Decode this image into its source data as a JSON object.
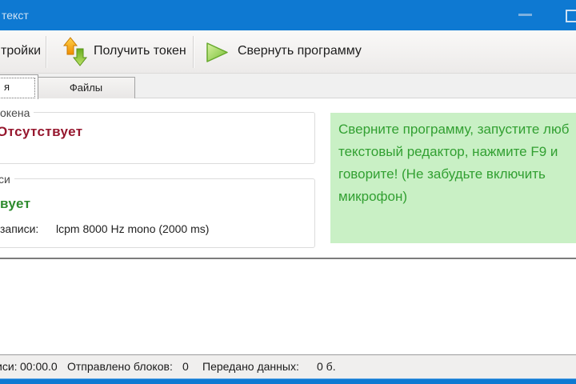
{
  "window": {
    "title_fragment": "текст"
  },
  "toolbar": {
    "settings_fragment": "тройки",
    "get_token": "Получить токен",
    "minimize_program": "Свернуть программу"
  },
  "tabs": {
    "main_fragment": "я",
    "files": "Файлы"
  },
  "main": {
    "token_group": {
      "title_fragment": "окена",
      "status": "Отсутствует"
    },
    "record_group": {
      "title_fragment": "си",
      "status_fragment": "вует",
      "format_label": "записи:",
      "format_value": "lcpm 8000 Hz mono (2000 ms)"
    },
    "hint": {
      "lines": [
        "Сверните программу, запустите люб",
        "текстовый редактор, нажмите F9 и",
        "говорите! (Не забудьте включить",
        "микрофон)"
      ]
    }
  },
  "status_bar": {
    "time_fragment": "иси:",
    "time_value": "00:00.0",
    "blocks_label": "Отправлено блоков:",
    "blocks_value": "0",
    "bytes_label": "Передано данных:",
    "bytes_value": "0 б."
  },
  "colors": {
    "titlebar": "#0e79d2",
    "token_status_text": "#96172e",
    "record_status_text": "#2e8b2e",
    "hint_background": "#c9f0c5",
    "hint_text": "#32a032"
  },
  "icons": {
    "get_token": "up-down-arrows-icon",
    "minimize_program": "play-triangle-icon",
    "window_minimize": "minimize-icon",
    "window_maximize": "maximize-icon"
  }
}
